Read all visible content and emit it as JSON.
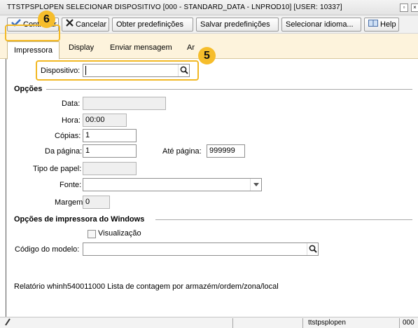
{
  "window": {
    "title": "TTSTPSPLOPEN  SELECIONAR DISPOSITIVO [000 - STANDARD_DATA - LNPROD10] [USER: 10337]"
  },
  "toolbar": {
    "continuar": "Continuar",
    "cancelar": "Cancelar",
    "obter": "Obter predefinições",
    "salvar": "Salvar predefinições",
    "selecionar_idioma": "Selecionar idioma...",
    "help": "Help"
  },
  "tabs": [
    "Impressora",
    "Display",
    "Enviar mensagem",
    "Ar"
  ],
  "form": {
    "dispositivo_label": "Dispositivo:",
    "dispositivo_value": ""
  },
  "opcoes": {
    "title": "Opções",
    "data_label": "Data:",
    "data_value": "",
    "hora_label": "Hora:",
    "hora_value": "00:00",
    "copias_label": "Cópias:",
    "copias_value": "1",
    "da_pagina_label": "Da página:",
    "da_pagina_value": "1",
    "ate_pagina_label": "Até página:",
    "ate_pagina_value": "999999",
    "tipo_papel_label": "Tipo de papel:",
    "tipo_papel_value": "",
    "fonte_label": "Fonte:",
    "fonte_value": "",
    "margem_label": "Margem:",
    "margem_value": "0"
  },
  "windows": {
    "title": "Opções de impressora do Windows",
    "visualizacao_label": "Visualização",
    "visualizacao_checked": false,
    "codigo_label": "Código do modelo:",
    "codigo_value": ""
  },
  "report_text": "Relatório whinh540011000 Lista de contagem por armazém/ordem/zona/local",
  "annotations": {
    "badge_6": "6",
    "badge_5": "5"
  },
  "statusbar": {
    "session": "ttstpsplopen",
    "company": "000"
  },
  "colors": {
    "highlight": "#f2b824",
    "tab_strip": "#fdf3dc"
  }
}
